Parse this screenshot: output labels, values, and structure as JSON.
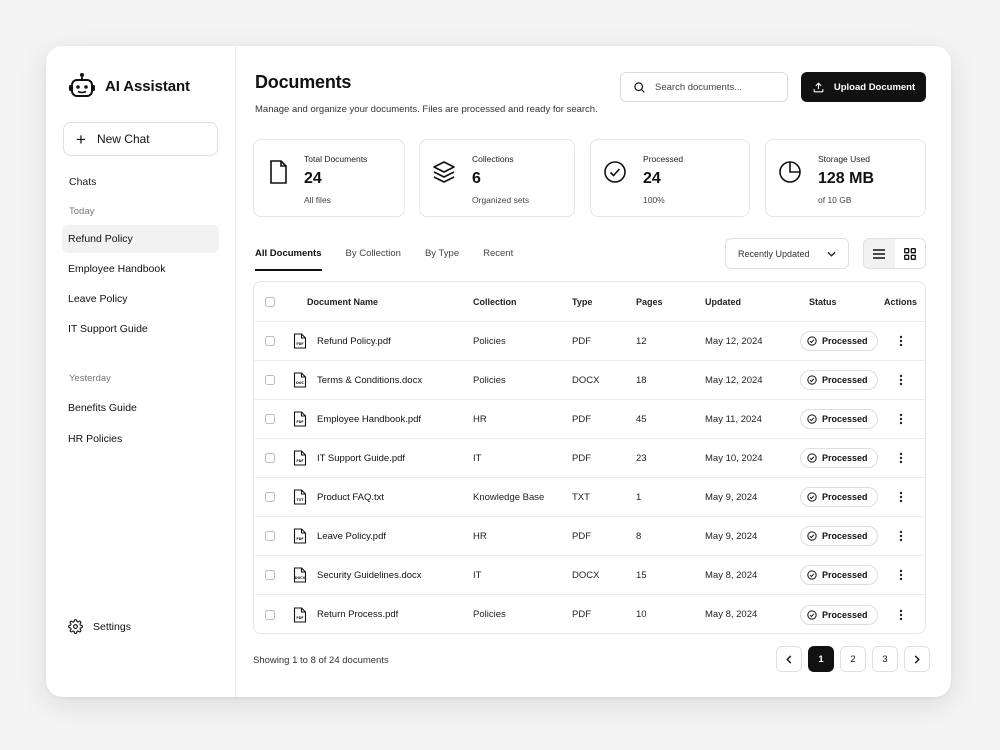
{
  "app": {
    "title": "AI Assistant"
  },
  "sidebar": {
    "new_chat_label": "New Chat",
    "chats_label": "Chats",
    "groups": [
      {
        "label": "Today",
        "items": [
          "Refund Policy",
          "Employee Handbook",
          "Leave Policy",
          "IT Support Guide"
        ]
      },
      {
        "label": "Yesterday",
        "items": [
          "Benefits Guide",
          "HR Policies"
        ]
      }
    ],
    "active_item": "Refund Policy",
    "settings_label": "Settings"
  },
  "header": {
    "title": "Documents",
    "subtitle": "Manage and organize your documents. Files are processed and ready for search.",
    "search_placeholder": "Search documents...",
    "upload_label": "Upload Document"
  },
  "stats": [
    {
      "label": "Total Documents",
      "value": "24",
      "sub": "All files",
      "icon": "file-icon"
    },
    {
      "label": "Collections",
      "value": "6",
      "sub": "Organized sets",
      "icon": "layers-icon"
    },
    {
      "label": "Processed",
      "value": "24",
      "sub": "100%",
      "icon": "check-circle-icon"
    },
    {
      "label": "Storage Used",
      "value": "128 MB",
      "sub": "of 10 GB",
      "icon": "pie-chart-icon"
    }
  ],
  "tabs": [
    "All Documents",
    "By Collection",
    "By Type",
    "Recent"
  ],
  "active_tab": "All Documents",
  "sort": {
    "selected": "Recently Updated"
  },
  "table": {
    "columns": [
      "Document Name",
      "Collection",
      "Type",
      "Pages",
      "Updated",
      "Status",
      "Actions"
    ],
    "rows": [
      {
        "name": "Refund Policy.pdf",
        "collection": "Policies",
        "type": "PDF",
        "pages": "12",
        "updated": "May 12, 2024",
        "status": "Processed"
      },
      {
        "name": "Terms & Conditions.docx",
        "collection": "Policies",
        "type": "DOCX",
        "pages": "18",
        "updated": "May 12, 2024",
        "status": "Processed"
      },
      {
        "name": "Employee Handbook.pdf",
        "collection": "HR",
        "type": "PDF",
        "pages": "45",
        "updated": "May 11, 2024",
        "status": "Processed"
      },
      {
        "name": "IT Support Guide.pdf",
        "collection": "IT",
        "type": "PDF",
        "pages": "23",
        "updated": "May 10, 2024",
        "status": "Processed"
      },
      {
        "name": "Product FAQ.txt",
        "collection": "Knowledge Base",
        "type": "TXT",
        "pages": "1",
        "updated": "May 9, 2024",
        "status": "Processed"
      },
      {
        "name": "Leave Policy.pdf",
        "collection": "HR",
        "type": "PDF",
        "pages": "8",
        "updated": "May 9, 2024",
        "status": "Processed"
      },
      {
        "name": "Security Guidelines.docx",
        "collection": "IT",
        "type": "DOCX",
        "pages": "15",
        "updated": "May 8, 2024",
        "status": "Processed"
      },
      {
        "name": "Return Process.pdf",
        "collection": "Policies",
        "type": "PDF",
        "pages": "10",
        "updated": "May 8, 2024",
        "status": "Processed"
      }
    ],
    "file_badges": [
      "PDF",
      "DOC",
      "PDF",
      "PDF",
      "TXT",
      "PDF",
      "DOCX",
      "PDF"
    ]
  },
  "footer": {
    "showing": "Showing 1 to 8 of 24 documents",
    "pages": [
      "1",
      "2",
      "3"
    ],
    "current_page": "1"
  }
}
